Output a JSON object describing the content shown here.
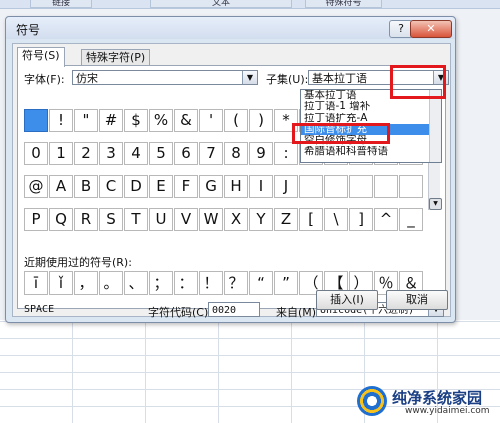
{
  "background": {
    "tabs": [
      "链接",
      "文本",
      "特殊符号"
    ]
  },
  "dialog": {
    "title": "符号",
    "help_label": "?",
    "close_label": "✕",
    "tabs": [
      {
        "label": "符号(S)"
      },
      {
        "label": "特殊字符(P)"
      }
    ],
    "font_label": "字体(F):",
    "font_value": "仿宋",
    "subset_label": "子集(U):",
    "subset_value": "基本拉丁语",
    "symbol_rows": [
      [
        " ",
        "!",
        "\"",
        "#",
        "$",
        "%",
        "&",
        "'",
        "(",
        ")",
        "*",
        "",
        "",
        "",
        "",
        ""
      ],
      [
        "0",
        "1",
        "2",
        "3",
        "4",
        "5",
        "6",
        "7",
        "8",
        "9",
        ":",
        "",
        "",
        "",
        "",
        ""
      ],
      [
        "@",
        "A",
        "B",
        "C",
        "D",
        "E",
        "F",
        "G",
        "H",
        "I",
        "J",
        "",
        "",
        "",
        "",
        ""
      ],
      [
        "P",
        "Q",
        "R",
        "S",
        "T",
        "U",
        "V",
        "W",
        "X",
        "Y",
        "Z",
        "[",
        "\\",
        "]",
        "^",
        "_"
      ]
    ],
    "subset_options": [
      {
        "label": "基本拉丁语",
        "highlighted": false
      },
      {
        "label": "拉丁语-1 增补",
        "highlighted": false
      },
      {
        "label": "拉丁语扩充-A",
        "highlighted": false
      },
      {
        "label": "国际音标扩充",
        "highlighted": true
      },
      {
        "label": "空白修饰字母",
        "highlighted": false
      },
      {
        "label": "希腊语和科普特语",
        "highlighted": false
      }
    ],
    "recent_label": "近期使用过的符号(R):",
    "recent_symbols": [
      "ī",
      "ǐ",
      "，",
      "。",
      "、",
      "；",
      "：",
      "！",
      "？",
      "“",
      "”",
      "（",
      "【",
      "）",
      "％",
      "＆"
    ],
    "char_name": "SPACE",
    "char_code_label": "字符代码(C):",
    "char_code_value": "0020",
    "from_label": "来自(M):",
    "from_value": "Unicode(十六进制)",
    "insert_label": "插入(I)",
    "cancel_label": "取消"
  },
  "watermark": {
    "text": "纯净系统家园",
    "url": "www.yidaimei.com"
  },
  "colors": {
    "selection": "#3d8eea",
    "highlight_box": "#e3181c"
  }
}
